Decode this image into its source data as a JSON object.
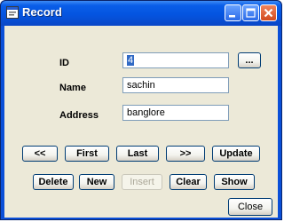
{
  "window": {
    "title": "Record"
  },
  "form": {
    "id_label": "ID",
    "id_value": "4",
    "name_label": "Name",
    "name_value": "sachin",
    "address_label": "Address",
    "address_value": "banglore",
    "browse_label": "..."
  },
  "nav_buttons": {
    "prev": "<<",
    "first": "First",
    "last": "Last",
    "next": ">>",
    "update": "Update"
  },
  "action_buttons": {
    "delete": "Delete",
    "new": "New",
    "insert": "Insert",
    "clear": "Clear",
    "show": "Show"
  },
  "close_button": "Close"
}
